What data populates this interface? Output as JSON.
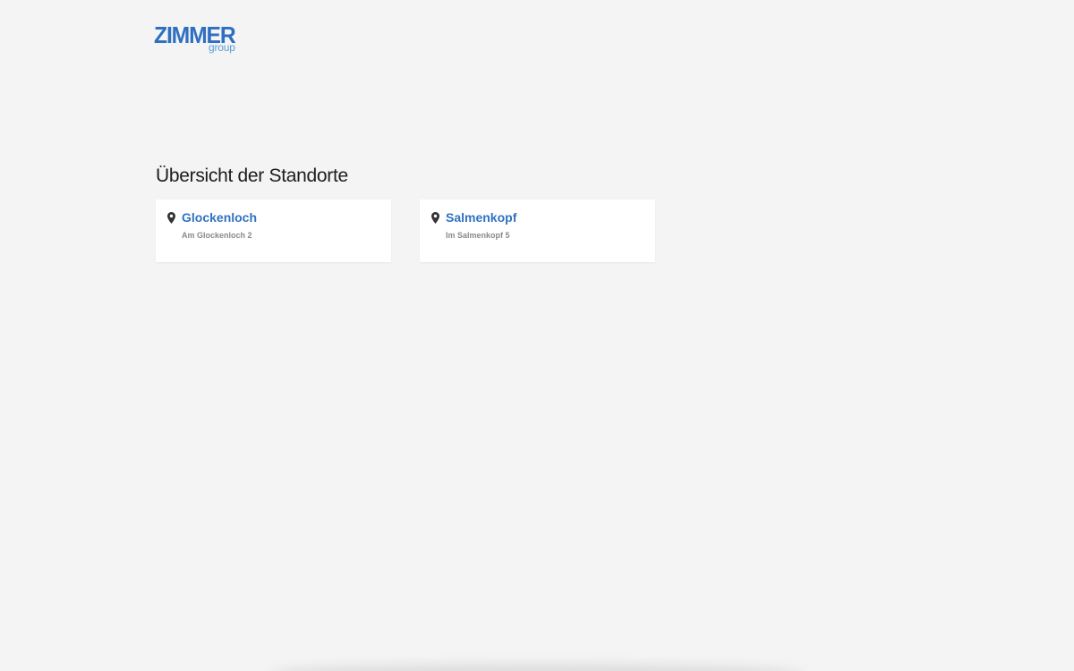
{
  "logo": {
    "main": "ZIMMER",
    "sub": "group",
    "color": "#2f6fc1"
  },
  "page_title": "Übersicht der Standorte",
  "locations": [
    {
      "name": "Glockenloch",
      "address": "Am Glockenloch 2",
      "icon": "map-pin-icon"
    },
    {
      "name": "Salmenkopf",
      "address": "Im Salmenkopf 5",
      "icon": "map-pin-icon"
    }
  ],
  "colors": {
    "background": "#f4f4f4",
    "card": "#ffffff",
    "link": "#2f72c2",
    "address": "#8a8a8a"
  }
}
